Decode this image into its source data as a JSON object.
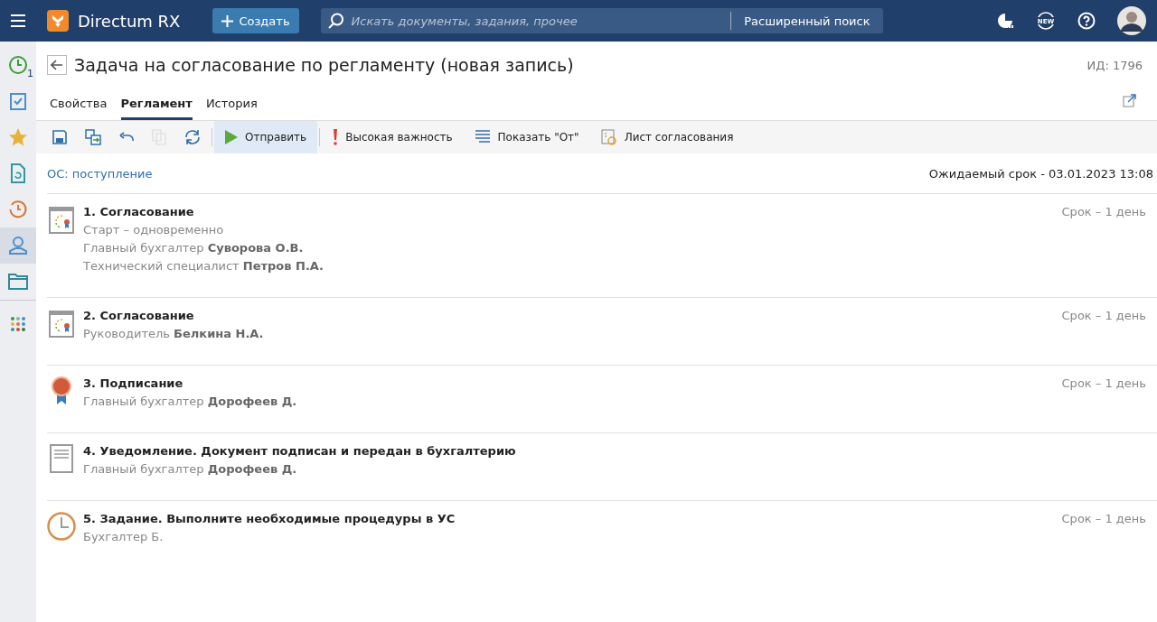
{
  "topbar": {
    "logo": "Directum RX",
    "create_button": "Создать",
    "search": {
      "placeholder": "Искать документы, задания, прочее"
    },
    "advanced_search": "Расширенный поиск",
    "new_badge": "NEW"
  },
  "sidebar": {
    "items": [
      {
        "kind": "clock",
        "badge": "1",
        "selected": false
      },
      {
        "kind": "tasks",
        "selected": false
      },
      {
        "kind": "star",
        "selected": false
      },
      {
        "kind": "doc",
        "selected": false
      },
      {
        "kind": "history",
        "selected": false
      },
      {
        "kind": "person",
        "selected": true
      },
      {
        "kind": "folder",
        "selected": false
      },
      {
        "kind": "apps",
        "selected": false
      }
    ]
  },
  "header": {
    "title": "Задача на согласование по регламенту (новая запись)",
    "id": "ИД: 1796"
  },
  "tabs": [
    {
      "label": "Свойства",
      "selected": false
    },
    {
      "label": "Регламент",
      "selected": true
    },
    {
      "label": "История",
      "selected": false
    }
  ],
  "toolbar": [
    {
      "kind": "save",
      "disabled": false,
      "highlighted": false
    },
    {
      "kind": "save-as",
      "disabled": false,
      "highlighted": false
    },
    {
      "kind": "undo",
      "disabled": false,
      "highlighted": false
    },
    {
      "kind": "copy",
      "disabled": true,
      "highlighted": false
    },
    {
      "kind": "refresh",
      "disabled": false,
      "highlighted": false
    },
    {
      "kind": "send",
      "label": "Отправить",
      "disabled": false,
      "highlighted": true
    },
    {
      "kind": "importance",
      "label": "Высокая важность",
      "disabled": false,
      "highlighted": false
    },
    {
      "kind": "show-from",
      "label": "Показать \"От\"",
      "disabled": false,
      "highlighted": false
    },
    {
      "kind": "sheet",
      "label": "Лист согласования",
      "disabled": false,
      "highlighted": false
    }
  ],
  "rule_link": "ОС: поступление",
  "expected_deadline": "Ожидаемый срок - 03.01.2023 13:08",
  "steps": [
    {
      "kind": "approval",
      "title": "1. Согласование",
      "deadline": "Срок – 1 день",
      "lines": [
        "Старт – одновременно",
        "Главный бухгалтер **Суворова О.В.**",
        "Технический специалист **Петров П.А.**"
      ]
    },
    {
      "kind": "approval",
      "title": "2. Согласование",
      "deadline": "Срок – 1 день",
      "lines": [
        "Руководитель **Белкина Н.А.**"
      ]
    },
    {
      "kind": "signing",
      "title": "3. Подписание",
      "deadline": "Срок – 1 день",
      "lines": [
        "Главный бухгалтер **Дорофеев Д.**"
      ]
    },
    {
      "kind": "notice",
      "title": "4. Уведомление. Документ подписан и передан в бухгалтерию",
      "lines": [
        "Главный бухгалтер **Дорофеев Д.**"
      ]
    },
    {
      "kind": "task",
      "title": "5. Задание. Выполните необходимые процедуры в УС",
      "deadline": "Срок – 1 день",
      "lines": [
        "Бухгалтер Б."
      ]
    }
  ]
}
